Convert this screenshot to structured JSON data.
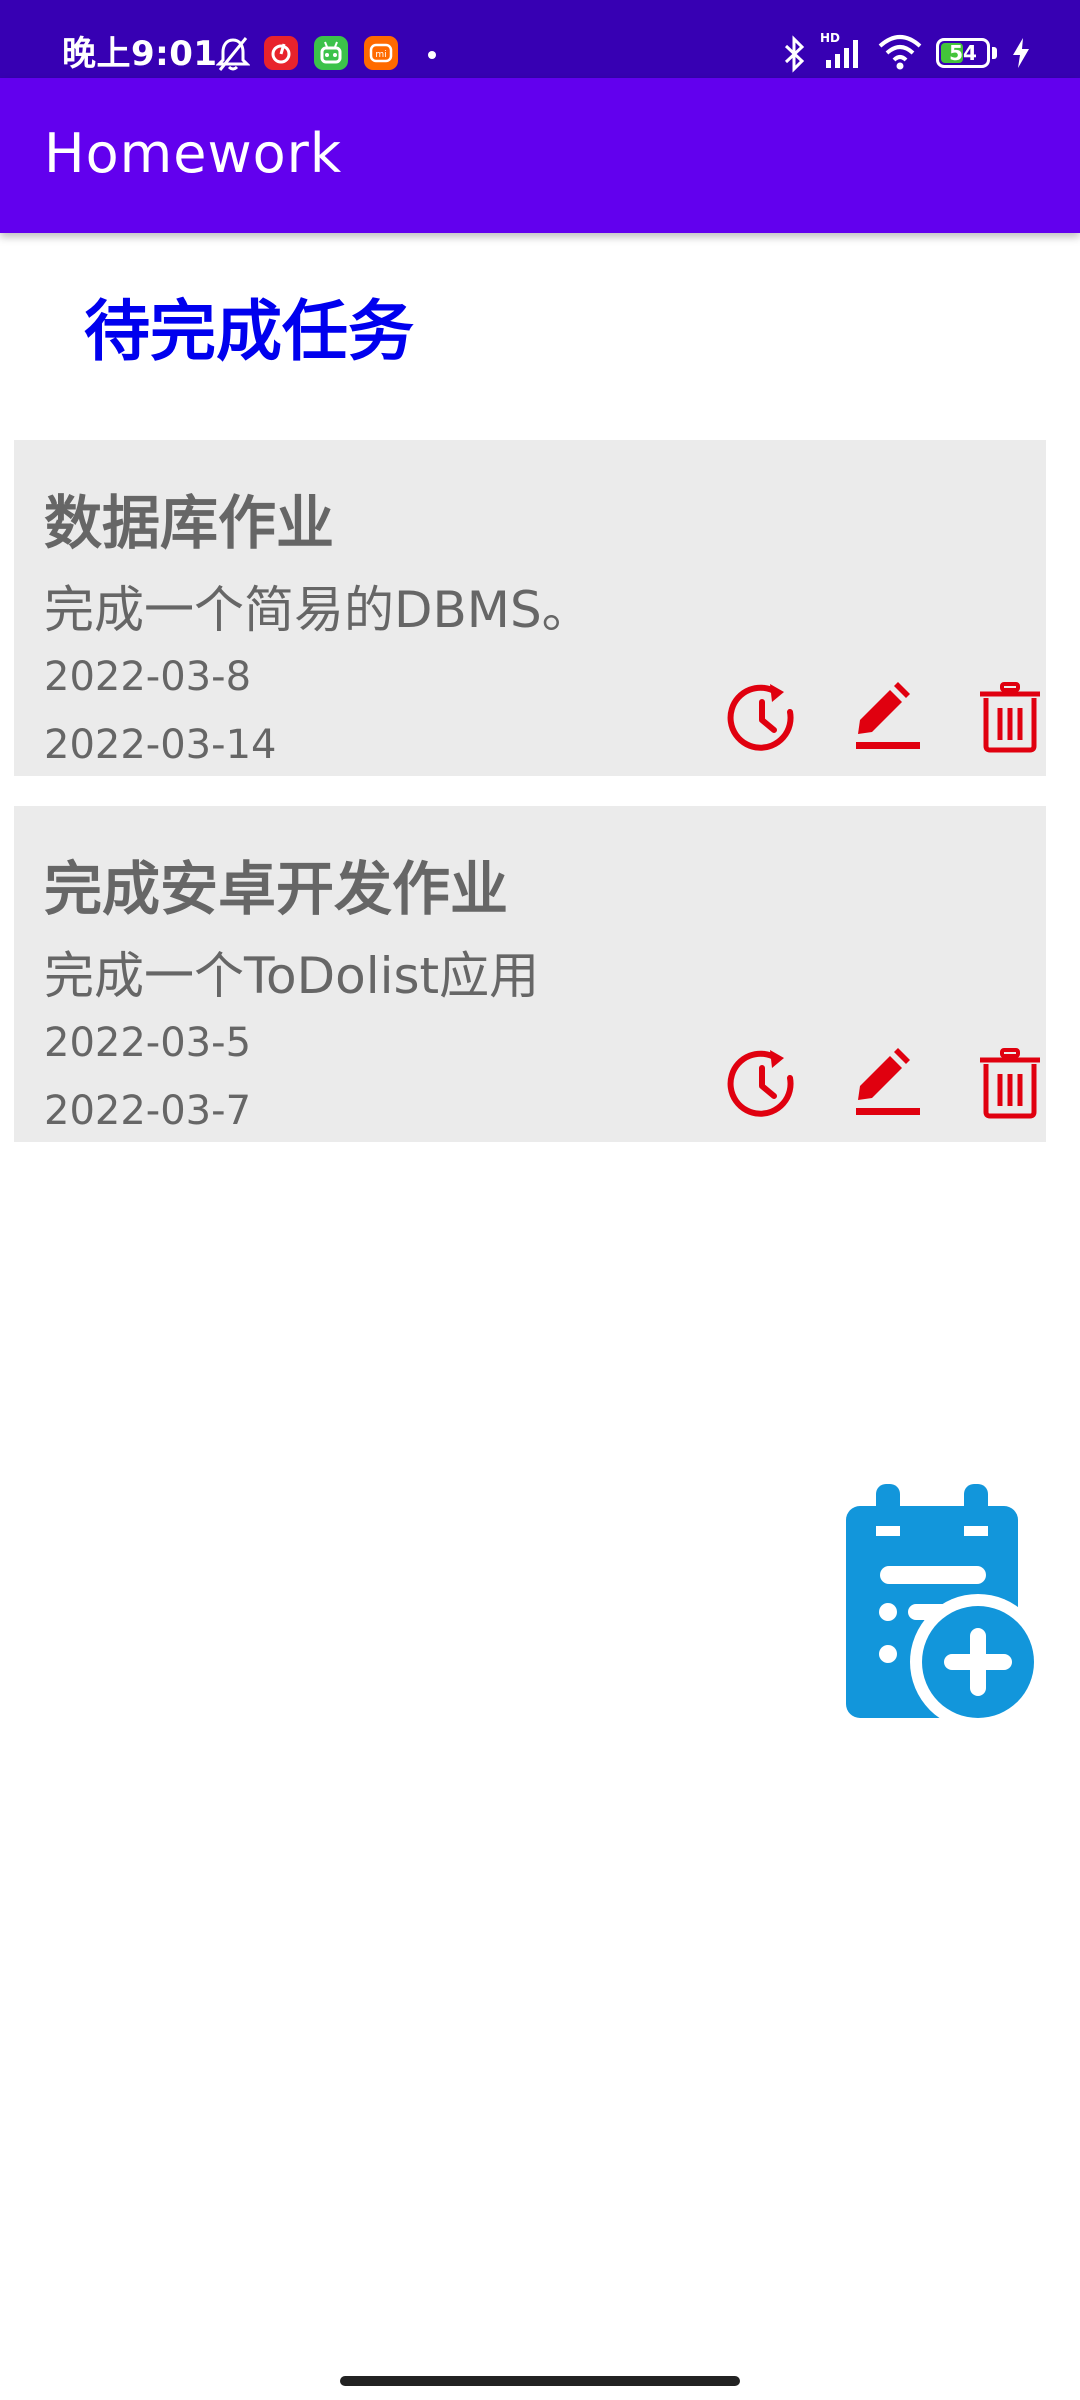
{
  "status_bar": {
    "time": "晚上9:01",
    "battery_level": "54",
    "battery_fraction": 0.54,
    "network_label": "HD",
    "icons": [
      "bell-off-icon",
      "netease-music-badge",
      "android-badge",
      "mi-badge",
      "bluetooth-icon",
      "cell-signal-icon",
      "wifi-icon",
      "battery-icon",
      "charging-bolt-icon"
    ]
  },
  "app_bar": {
    "title": "Homework"
  },
  "section": {
    "title": "待完成任务"
  },
  "tasks": [
    {
      "title": "数据库作业",
      "description": "完成一个简易的DBMS。",
      "start_date": "2022-03-8",
      "end_date": "2022-03-14",
      "actions": [
        "postpone-icon",
        "edit-icon",
        "delete-icon"
      ]
    },
    {
      "title": "完成安卓开发作业",
      "description": "完成一个ToDolist应用",
      "start_date": "2022-03-5",
      "end_date": "2022-03-7",
      "actions": [
        "postpone-icon",
        "edit-icon",
        "delete-icon"
      ]
    }
  ],
  "fab": {
    "icon": "calendar-add-icon"
  },
  "colors": {
    "status_bar": "#3700B3",
    "app_bar": "#6200EE",
    "section_title": "#0000EE",
    "card_bg": "#EBEBEB",
    "card_text": "#666666",
    "action_icon": "#E0000F",
    "fab": "#1296DB"
  }
}
